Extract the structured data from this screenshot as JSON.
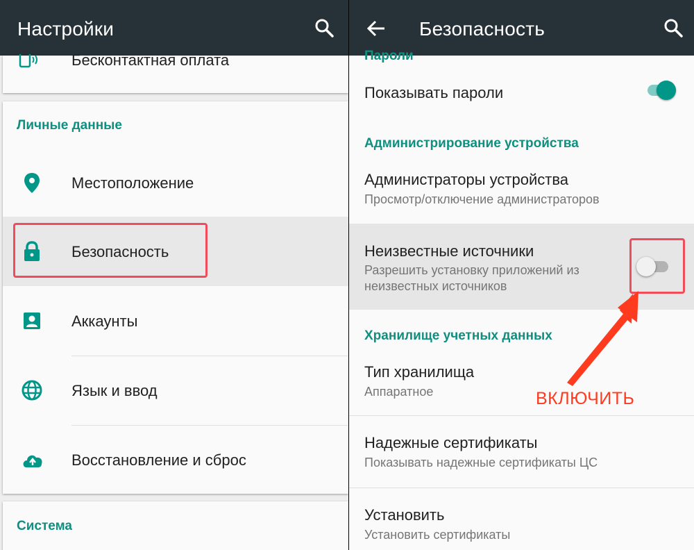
{
  "left": {
    "title": "Настройки",
    "top_item": "Бесконтактная оплата",
    "section_personal": "Личные данные",
    "items": [
      {
        "label": "Местоположение"
      },
      {
        "label": "Безопасность"
      },
      {
        "label": "Аккаунты"
      },
      {
        "label": "Язык и ввод"
      },
      {
        "label": "Восстановление и сброс"
      }
    ],
    "section_system": "Система"
  },
  "right": {
    "title": "Безопасность",
    "section_passwords": "Пароли",
    "show_passwords": {
      "label": "Показывать пароли",
      "enabled": true
    },
    "section_admin": "Администрирование устройства",
    "device_admins": {
      "title": "Администраторы устройства",
      "subtitle": "Просмотр/отключение администраторов"
    },
    "unknown_sources": {
      "title": "Неизвестные источники",
      "subtitle_line1": "Разрешить установку приложений из",
      "subtitle_line2": "неизвестных источников",
      "enabled": false
    },
    "section_storage": "Хранилище учетных данных",
    "storage_type": {
      "title": "Тип хранилища",
      "subtitle": "Аппаратное"
    },
    "trusted_certs": {
      "title": "Надежные сертификаты",
      "subtitle": "Показывать надежные сертификаты ЦС"
    },
    "install": {
      "title": "Установить",
      "subtitle": "Установить сертификаты"
    }
  },
  "annotation": {
    "label": "ВКЛЮЧИТЬ",
    "color": "#ff3b1f"
  },
  "colors": {
    "appbar": "#263238",
    "accent": "#009688",
    "highlight_frame": "#f04c5c"
  }
}
